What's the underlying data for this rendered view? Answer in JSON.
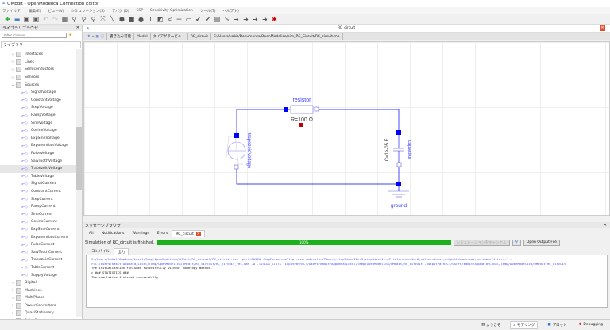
{
  "window": {
    "title": "OMEdit - OpenModelica Connection Editor"
  },
  "menu": [
    "ファイル(F)",
    "編集(E)",
    "ビュー(V)",
    "シミュレーション(S)",
    "デバグ (D)",
    "SSP",
    "Sensitivity Optimization",
    "ツール(T)",
    "ヘルプ(H)"
  ],
  "library": {
    "title": "ライブラリブラウザ",
    "filter_placeholder": "Filter Classes",
    "header": "ライブラリ",
    "items": [
      {
        "label": "Interfaces",
        "type": "package"
      },
      {
        "label": "Lines",
        "type": "package"
      },
      {
        "label": "Semiconductors",
        "type": "package"
      },
      {
        "label": "Sensors",
        "type": "package"
      },
      {
        "label": "Sources",
        "type": "package",
        "expanded": true
      },
      {
        "label": "SignalVoltage",
        "type": "class"
      },
      {
        "label": "ConstantVoltage",
        "type": "class"
      },
      {
        "label": "StepVoltage",
        "type": "class"
      },
      {
        "label": "RampVoltage",
        "type": "class"
      },
      {
        "label": "SineVoltage",
        "type": "class"
      },
      {
        "label": "CosineVoltage",
        "type": "class"
      },
      {
        "label": "ExpSineVoltage",
        "type": "class"
      },
      {
        "label": "ExponentialsVoltage",
        "type": "class"
      },
      {
        "label": "PulseVoltage",
        "type": "class"
      },
      {
        "label": "SawToothVoltage",
        "type": "class"
      },
      {
        "label": "TrapezoidVoltage",
        "type": "class",
        "selected": true
      },
      {
        "label": "TableVoltage",
        "type": "class"
      },
      {
        "label": "SignalCurrent",
        "type": "class"
      },
      {
        "label": "ConstantCurrent",
        "type": "class"
      },
      {
        "label": "StepCurrent",
        "type": "class"
      },
      {
        "label": "RampCurrent",
        "type": "class"
      },
      {
        "label": "SineCurrent",
        "type": "class"
      },
      {
        "label": "CosineCurrent",
        "type": "class"
      },
      {
        "label": "ExpSineCurrent",
        "type": "class"
      },
      {
        "label": "ExponentialsCurrent",
        "type": "class"
      },
      {
        "label": "PulseCurrent",
        "type": "class"
      },
      {
        "label": "SawToothCurrent",
        "type": "class"
      },
      {
        "label": "TrapezoidCurrent",
        "type": "class"
      },
      {
        "label": "TableCurrent",
        "type": "class"
      },
      {
        "label": "SupplyVoltage",
        "type": "class"
      },
      {
        "label": "Digital",
        "type": "package"
      },
      {
        "label": "Machines",
        "type": "package"
      },
      {
        "label": "MultiPhase",
        "type": "package"
      },
      {
        "label": "PowerConverters",
        "type": "package"
      },
      {
        "label": "QuasiStationary",
        "type": "package"
      },
      {
        "label": "Spice3",
        "type": "package"
      }
    ]
  },
  "editor": {
    "tab_title": "RC_circuit",
    "toolbar": {
      "access": "書き込み可能",
      "kind": "Model",
      "view": "ダイアグラムビュー",
      "class_name": "RC_circuit",
      "path": "C:/Users/kakit/Documents/OpenModelica/sim_RC_Circuit/RC_circuit.mo"
    },
    "diagram": {
      "resistor_name": "resistor",
      "resistor_param": "R=100 Ω",
      "source_name": "trapezoidVoltage",
      "capacitor_name": "capacitor",
      "capacitor_param": "C=1e-05 F",
      "ground_name": "ground",
      "wire_color": "#0000ff"
    }
  },
  "messages": {
    "title": "メッセージブラウザ",
    "tabs": [
      "All",
      "Notifications",
      "Warnings",
      "Errors",
      "RC_circuit"
    ],
    "active_tab": "RC_circuit",
    "sim_status": "Simulation of RC_circuit is finished.",
    "progress_percent": 100,
    "progress_label": "100%",
    "cancel_label": "シミュレーションをキャンセル",
    "open_output_label": "Open Output File",
    "subtabs": [
      "コンパイル",
      "出力"
    ],
    "active_subtab": "出力",
    "output": {
      "command": "C:/Users/kakit/AppData/Local/Temp/OpenModelica/OMEdit/RC_circuit/RC_circuit.exe -port=50350 -logFormat=xmltcp -override=startTime=0,stopTime=10e-3,stepSize=1e-07,tolerance=1e-6,solver=dassl,outputFormat=mat,variableFilter=.* -r=C:/Users/kakit/AppData/Local/Temp/OpenModelica/OMEdit/RC_circuit/RC_circuit_res.mat -w -lv=LOG_STATS -inputPath=C:/Users/kakit/AppData/Local/Temp/OpenModelica/OMEdit/RC_circuit -outputPath=C:/Users/kakit/AppData/Local/Temp/OpenModelica/OMEdit/RC_circuit",
      "init": "The initialization finished successfully without homotopy method.",
      "stats": "### STATISTICS ###",
      "done": "The simulation finished successfully."
    },
    "progress_color": "#1cb11c"
  },
  "perspectives": [
    {
      "label": "ようこそ",
      "icon": "welcome-icon"
    },
    {
      "label": "モデリング",
      "icon": "modeling-icon",
      "active": true
    },
    {
      "label": "プロット",
      "icon": "plot-icon"
    },
    {
      "label": "Debugging",
      "icon": "debug-icon"
    }
  ]
}
